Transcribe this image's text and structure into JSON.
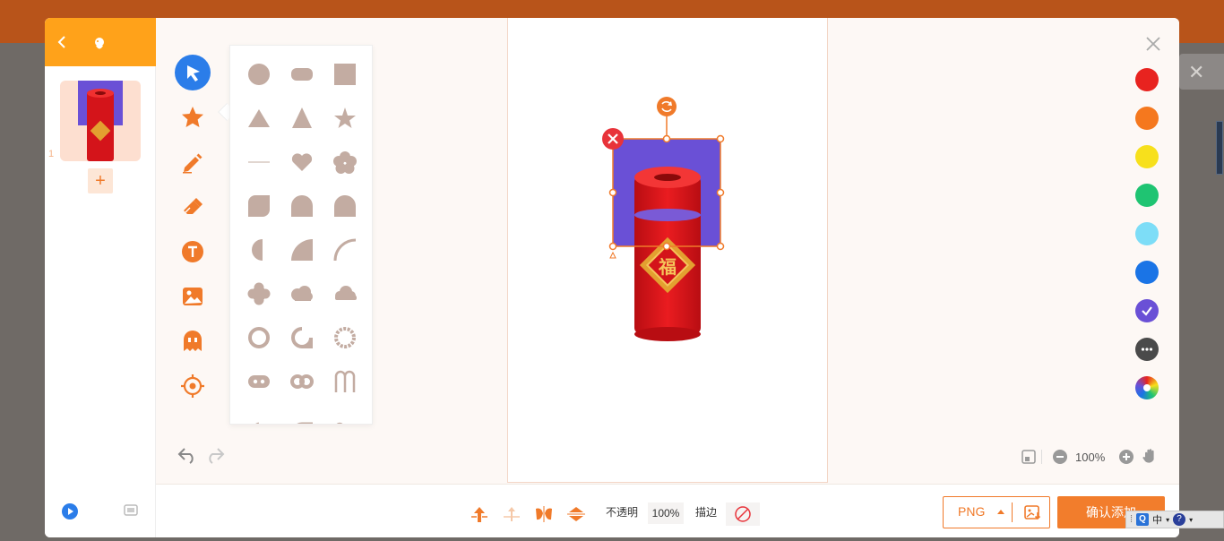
{
  "editor": {
    "page_index": "1",
    "add_page": "+",
    "opacity_label": "不透明",
    "opacity_value": "100%",
    "stroke_label": "描边",
    "zoom_value": "100%",
    "format_value": "PNG",
    "confirm_label": "确认添加"
  },
  "background": {
    "close_glyph": "✕"
  },
  "taskbar": {
    "input_method": "中"
  },
  "colors": {
    "accent": "#f27d2c",
    "header": "#ffa21a",
    "select_blue": "#2b7de9",
    "shape_gray": "#c3aca2"
  },
  "swatches": [
    "#e8231f",
    "#f5781e",
    "#f7e01c",
    "#1fc472",
    "#7dddf7",
    "#1a74e6",
    "#6a50d6",
    "#4a4a4a",
    "rainbow"
  ],
  "tools": [
    "select-icon",
    "shape-star-icon",
    "pen-icon",
    "eraser-icon",
    "text-icon",
    "image-icon",
    "ghost-icon",
    "target-icon"
  ],
  "shapes": [
    "circle",
    "rounded-rect",
    "square",
    "triangle",
    "triangle-tall",
    "star",
    "line",
    "heart",
    "flower",
    "rounded-square",
    "leaf",
    "arch",
    "half-circle",
    "quarter-circle",
    "arc",
    "cross",
    "cloud",
    "cloud-flat",
    "ring",
    "ring-notch",
    "ring-dotted",
    "pill-eyes",
    "double-ring",
    "magnet"
  ]
}
